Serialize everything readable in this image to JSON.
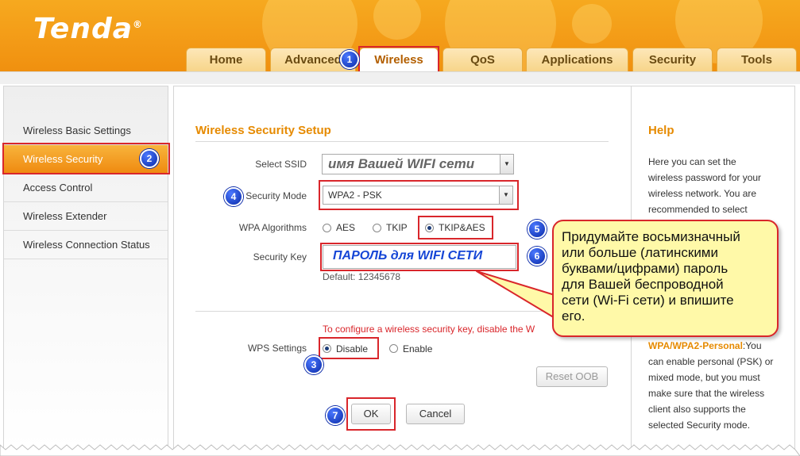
{
  "brand": {
    "logo": "Tenda",
    "reg": "®"
  },
  "colors": {
    "accent": "#e68a00",
    "header": "#f39a16",
    "annotation_red": "#d9262b",
    "marker_blue": "#0a2aa8",
    "callout_bg": "#fff9a8"
  },
  "tabs": [
    {
      "label": "Home"
    },
    {
      "label": "Advanced"
    },
    {
      "label": "Wireless"
    },
    {
      "label": "QoS"
    },
    {
      "label": "Applications"
    },
    {
      "label": "Security"
    },
    {
      "label": "Tools"
    }
  ],
  "sidebar": {
    "items": [
      {
        "label": "Wireless Basic Settings"
      },
      {
        "label": "Wireless Security"
      },
      {
        "label": "Access Control"
      },
      {
        "label": "Wireless Extender"
      },
      {
        "label": "Wireless Connection Status"
      }
    ]
  },
  "form": {
    "title": "Wireless Security Setup",
    "ssid_label": "Select SSID",
    "ssid_value": "имя Вашей WIFI сети",
    "mode_label": "Security Mode",
    "mode_value": "WPA2 - PSK",
    "algo_label": "WPA Algorithms",
    "algo_options": [
      "AES",
      "TKIP",
      "TKIP&AES"
    ],
    "key_label": "Security Key",
    "key_value": "ПАРОЛЬ для WIFI СЕТИ",
    "default_hint": "Default: 12345678",
    "wps_warning": "To configure a wireless security key, disable the W",
    "wps_label": "WPS Settings",
    "wps_options": [
      "Disable",
      "Enable"
    ],
    "reset_label": "Reset OOB",
    "ok_label": "OK",
    "cancel_label": "Cancel"
  },
  "help": {
    "title": "Help",
    "lines": [
      "Here you can set the",
      "wireless password for your",
      "wireless network. You are",
      "recommended to select"
    ],
    "term": "WPA/WPA2-Personal",
    "term_suffix": ":You",
    "lines2": [
      "can enable personal (PSK) or",
      "mixed mode, but you must",
      "make sure that the wireless",
      "client also supports the",
      "selected Security mode."
    ]
  },
  "annotation": {
    "markers": [
      "1",
      "2",
      "3",
      "4",
      "5",
      "6",
      "7"
    ],
    "callout_lines": [
      "Придумайте восьмизначный",
      "или больше (латинскими",
      "буквами/цифрами) пароль",
      "для Вашей беспроводной",
      "сети (Wi-Fi сети) и впишите",
      "его."
    ]
  }
}
